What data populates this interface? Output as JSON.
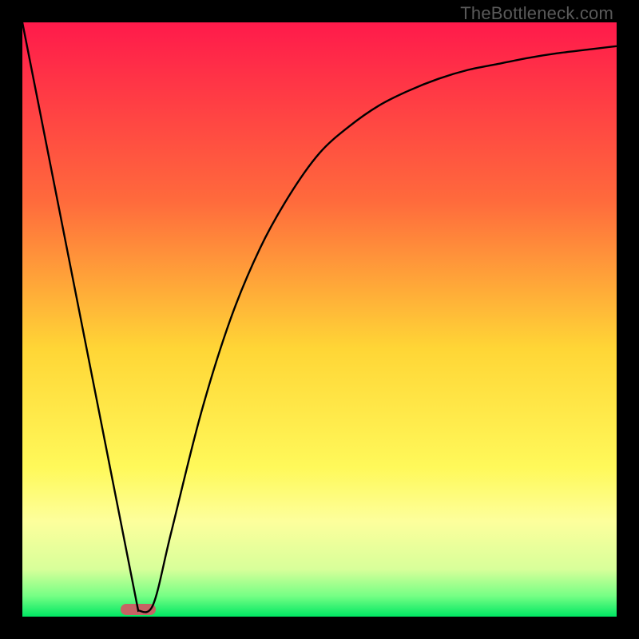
{
  "watermark": "TheBottleneck.com",
  "chart_data": {
    "type": "line",
    "title": "",
    "xlabel": "",
    "ylabel": "",
    "x_range": [
      0,
      100
    ],
    "y_range": [
      0,
      100
    ],
    "gradient_stops": [
      {
        "pos": 0.0,
        "color": "#ff1a4b"
      },
      {
        "pos": 0.3,
        "color": "#ff6a3c"
      },
      {
        "pos": 0.55,
        "color": "#ffd636"
      },
      {
        "pos": 0.75,
        "color": "#fff95a"
      },
      {
        "pos": 0.84,
        "color": "#fdff9c"
      },
      {
        "pos": 0.92,
        "color": "#d8ff9a"
      },
      {
        "pos": 0.965,
        "color": "#76ff85"
      },
      {
        "pos": 1.0,
        "color": "#00e763"
      }
    ],
    "series": [
      {
        "name": "bottleneck-curve",
        "x": [
          0,
          5,
          10,
          15,
          19.5,
          22,
          25,
          30,
          35,
          40,
          45,
          50,
          55,
          60,
          65,
          70,
          75,
          80,
          85,
          90,
          95,
          100
        ],
        "y": [
          100,
          75,
          49,
          24,
          1,
          2,
          14,
          34,
          50,
          62,
          71,
          78,
          82.5,
          86,
          88.5,
          90.5,
          92,
          93,
          94,
          94.8,
          95.4,
          96
        ]
      }
    ],
    "marker": {
      "x_center": 19.5,
      "width_pct": 6,
      "color": "#c76364"
    }
  }
}
